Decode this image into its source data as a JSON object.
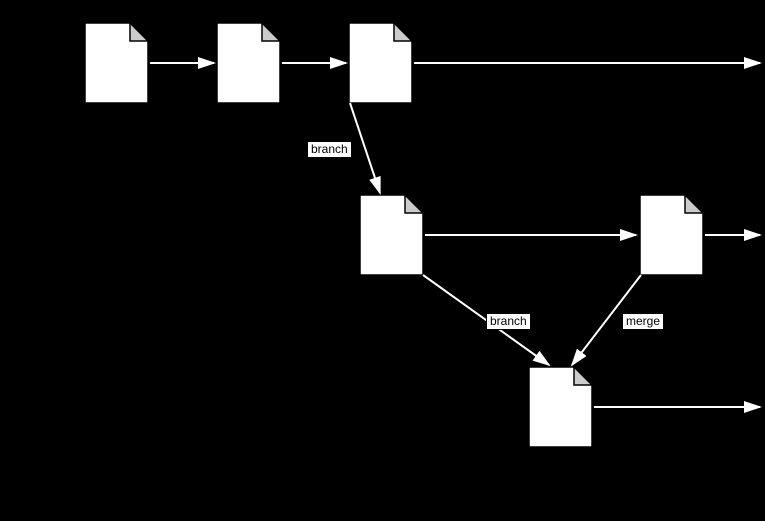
{
  "labels": {
    "branch1": "branch",
    "branch2": "branch",
    "merge": "merge"
  }
}
